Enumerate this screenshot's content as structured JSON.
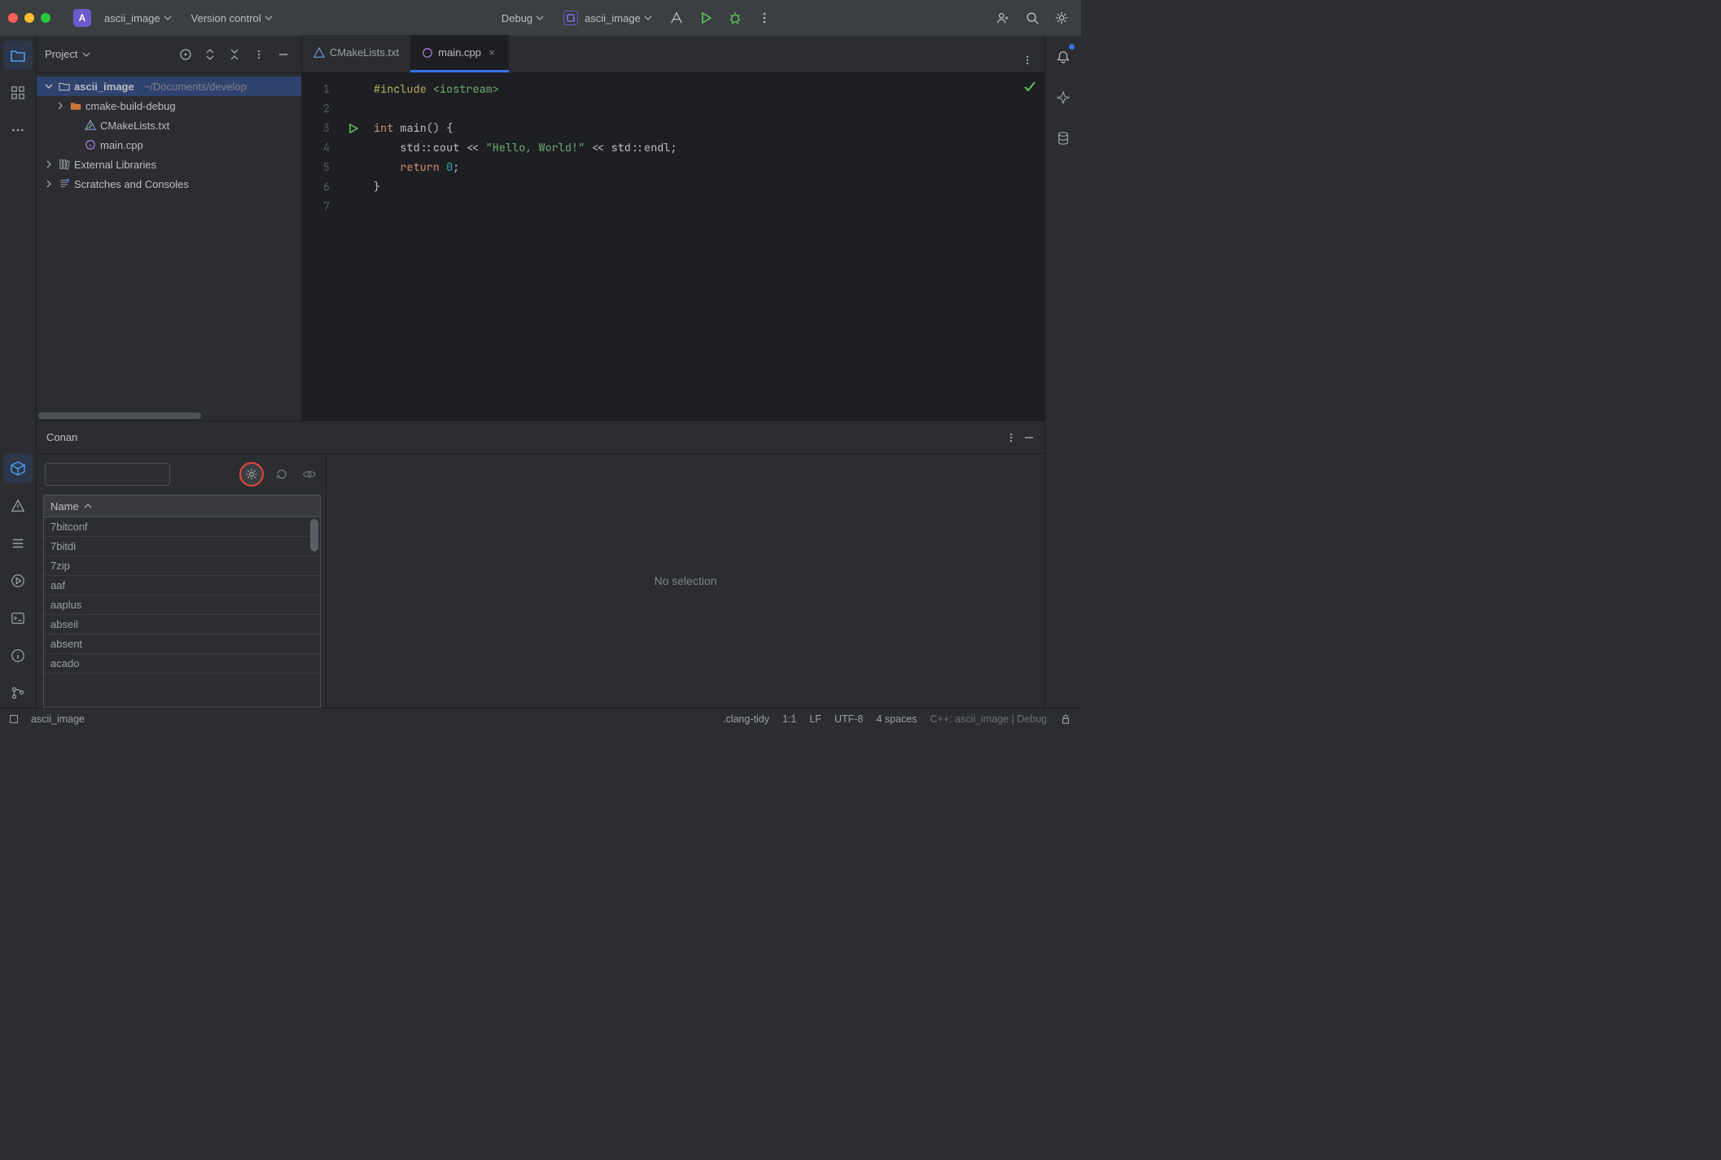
{
  "titlebar": {
    "project_name": "ascii_image",
    "version_control": "Version control",
    "run_config_label": "Debug",
    "run_target": "ascii_image"
  },
  "project_panel": {
    "title": "Project",
    "root": {
      "name": "ascii_image",
      "path": "~/Documents/develop"
    },
    "folder_debug": "cmake-build-debug",
    "file_cmake": "CMakeLists.txt",
    "file_main": "main.cpp",
    "external_libs": "External Libraries",
    "scratches": "Scratches and Consoles"
  },
  "tabs": {
    "cmake": "CMakeLists.txt",
    "main": "main.cpp"
  },
  "code": {
    "line_count": 7,
    "l1a": "#include",
    "l1b": " <iostream>",
    "l3a": "int",
    "l3b": " main() {",
    "l4a": "    std::cout << ",
    "l4b": "\"Hello, World!\"",
    "l4c": " << std::endl;",
    "l5a": "    return ",
    "l5b": "0",
    "l5c": ";",
    "l6": "}"
  },
  "conan": {
    "title": "Conan",
    "search_placeholder": "",
    "name_header": "Name",
    "rows": [
      "7bitconf",
      "7bitdi",
      "7zip",
      "aaf",
      "aaplus",
      "abseil",
      "absent",
      "acado"
    ],
    "empty_text": "No selection"
  },
  "statusbar": {
    "branch": "ascii_image",
    "clang": ".clang-tidy",
    "pos": "1:1",
    "eol": "LF",
    "encoding": "UTF-8",
    "indent": "4 spaces",
    "ctx": "C++: ascii_image | Debug"
  }
}
